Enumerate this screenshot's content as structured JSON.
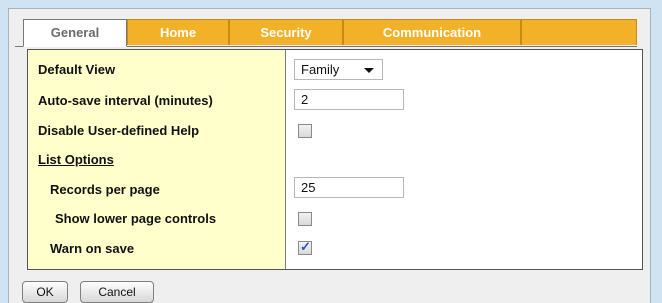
{
  "tabs": [
    {
      "label": "General",
      "active": true
    },
    {
      "label": "Home",
      "active": false
    },
    {
      "label": "Security",
      "active": false
    },
    {
      "label": "Communication",
      "active": false
    }
  ],
  "form": {
    "default_view": {
      "label": "Default View",
      "value": "Family"
    },
    "autosave": {
      "label": "Auto-save interval (minutes)",
      "value": "2"
    },
    "disable_help": {
      "label": "Disable User-defined Help",
      "checked": false
    },
    "list_options": {
      "label": "List Options"
    },
    "records_per_page": {
      "label": "Records per page",
      "value": "25"
    },
    "lower_controls": {
      "label": "Show lower page controls",
      "checked": false
    },
    "warn_on_save": {
      "label": "Warn on save",
      "checked": true
    }
  },
  "buttons": {
    "ok": "OK",
    "cancel": "Cancel"
  },
  "colors": {
    "background": "#cfe3f3",
    "tab_inactive": "#f3b12a",
    "label_column": "#ffffcc",
    "check": "#2e56b8"
  },
  "icons": {
    "dropdown": "chevron-down-icon",
    "checkmark": "checkmark-icon"
  }
}
